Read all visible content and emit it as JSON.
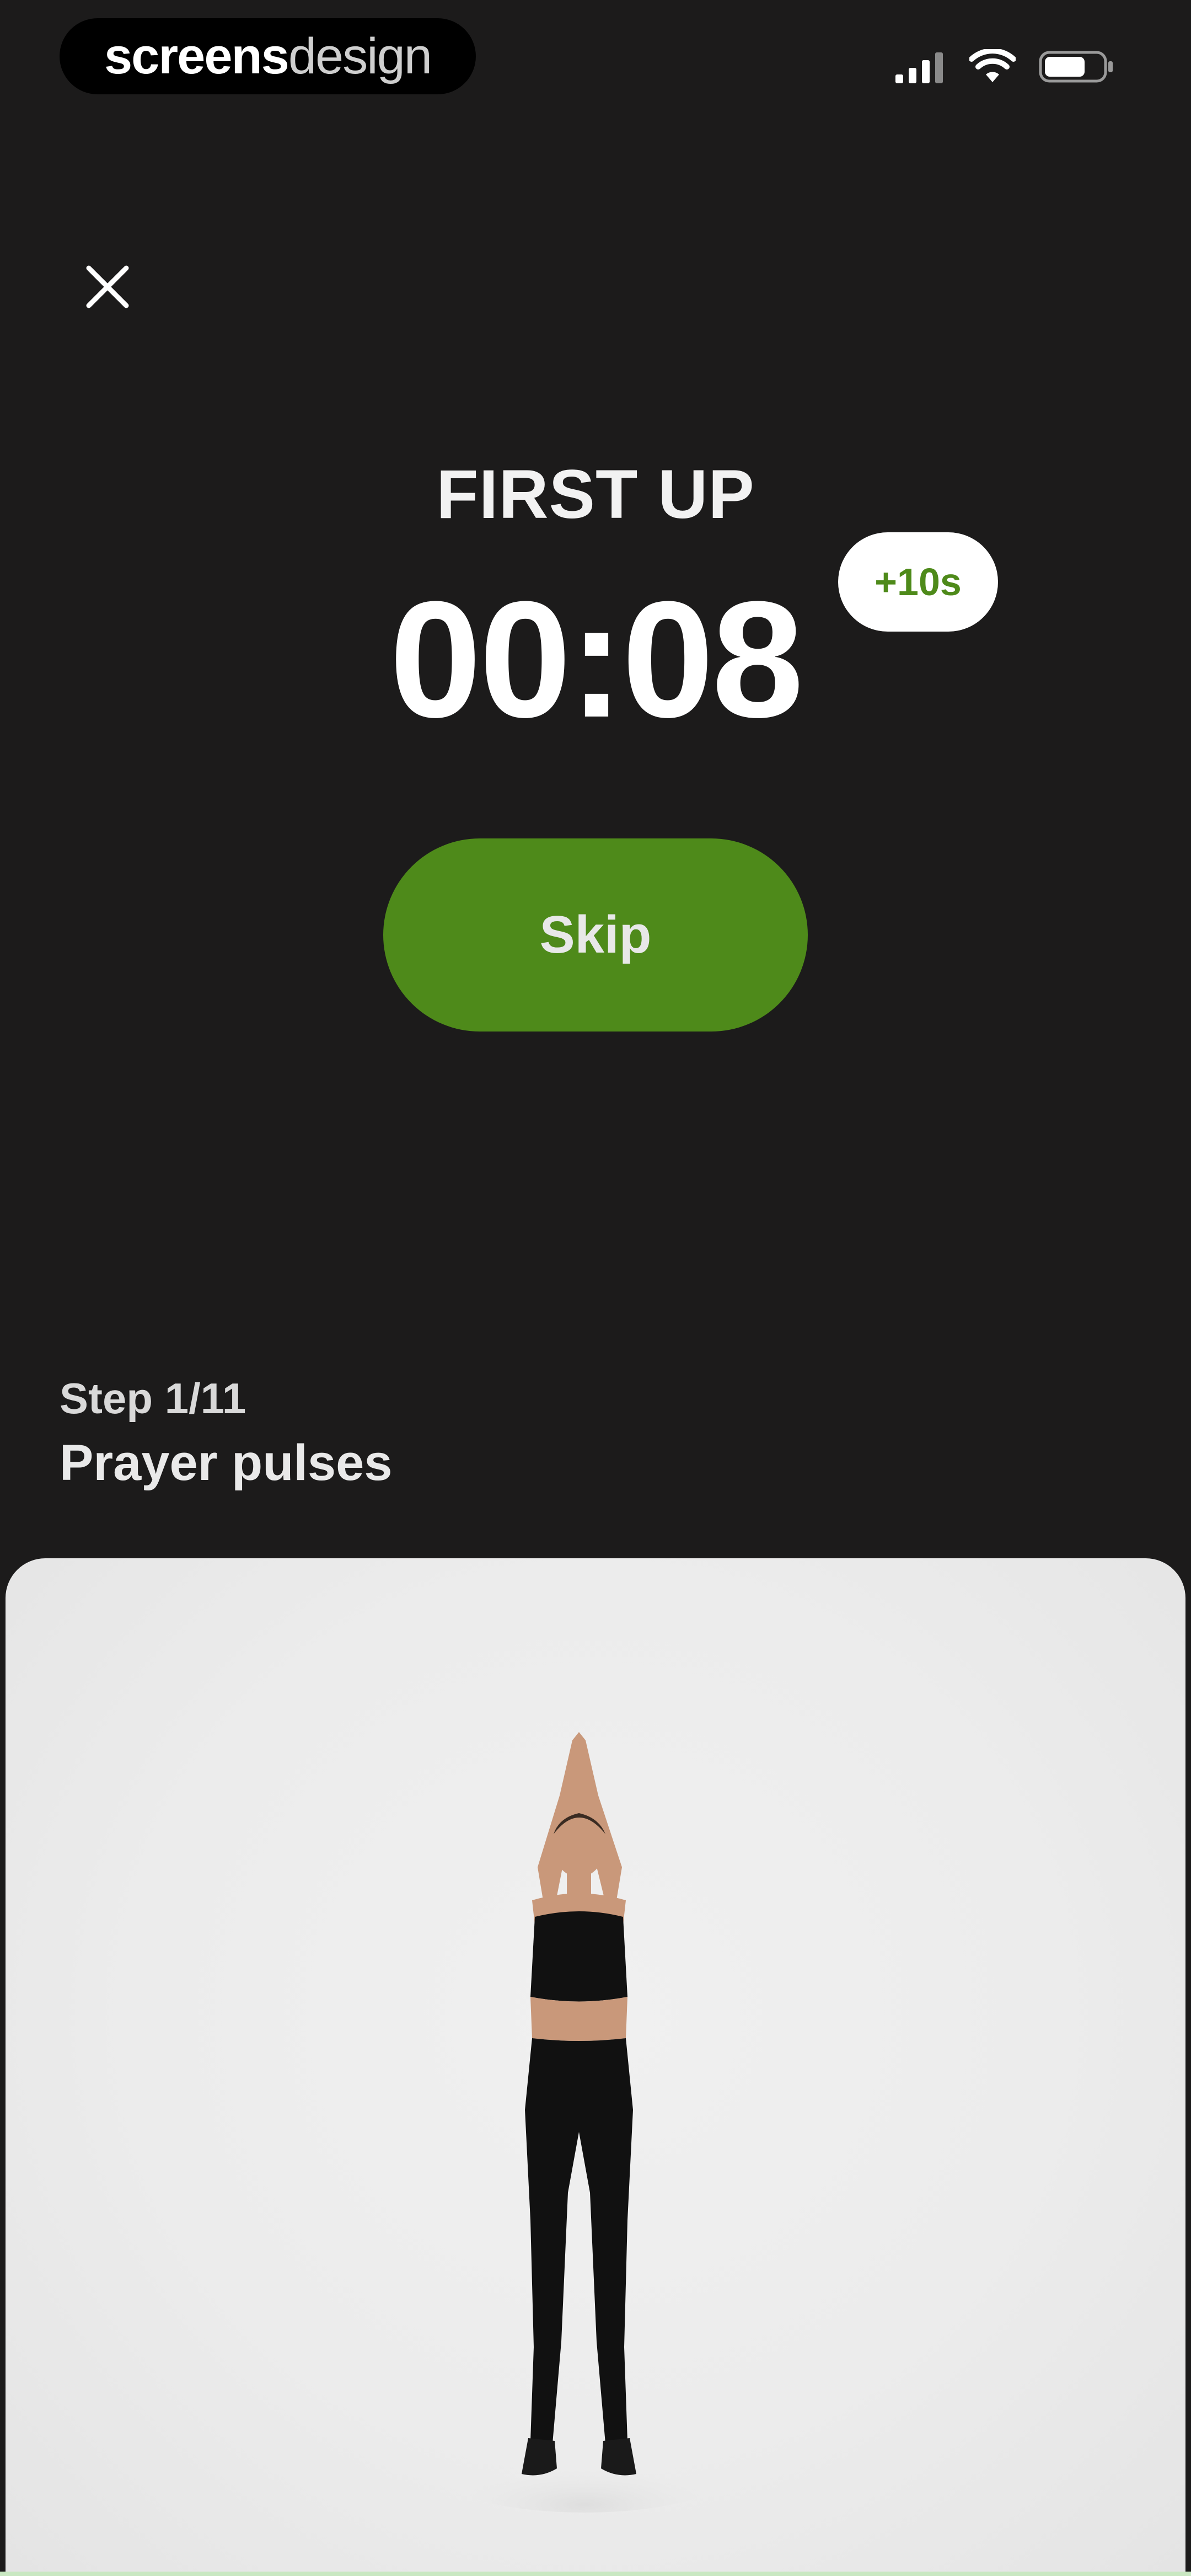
{
  "status_bar": {
    "brand_bold": "screens",
    "brand_light": "design",
    "icons": [
      "signal-icon",
      "wifi-icon",
      "battery-icon"
    ]
  },
  "header": {
    "close_icon": "close-icon"
  },
  "timer": {
    "heading": "FIRST UP",
    "time": "00:08",
    "add_time_label": "+10s"
  },
  "actions": {
    "skip_label": "Skip"
  },
  "exercise": {
    "step": "Step 1/11",
    "name": "Prayer pulses",
    "media": "exercise-demo-image"
  },
  "colors": {
    "background": "#1c1b1b",
    "accent": "#4e8a1a",
    "badge_bg": "#ffffff",
    "media_bg": "#ececec"
  }
}
